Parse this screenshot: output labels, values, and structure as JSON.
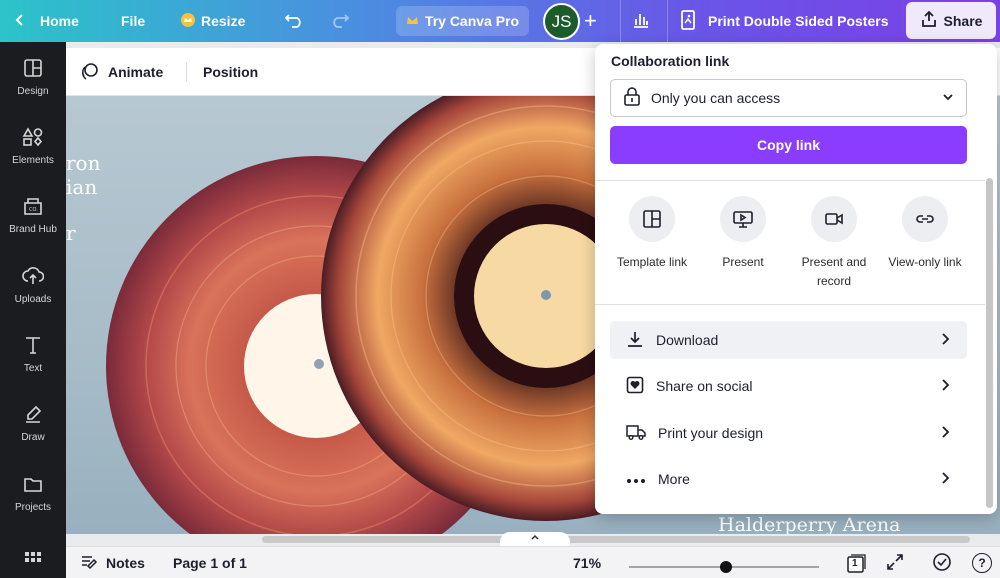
{
  "topbar": {
    "home": "Home",
    "file": "File",
    "resize": "Resize",
    "try_pro": "Try Canva Pro",
    "avatar_initials": "JS",
    "plus": "+",
    "design_title": "Print Double Sided Posters",
    "share": "Share"
  },
  "sidebar": {
    "items": [
      {
        "label": "Design",
        "icon": "design-icon"
      },
      {
        "label": "Elements",
        "icon": "elements-icon"
      },
      {
        "label": "Brand Hub",
        "icon": "brand-hub-icon"
      },
      {
        "label": "Uploads",
        "icon": "uploads-icon"
      },
      {
        "label": "Text",
        "icon": "text-icon"
      },
      {
        "label": "Draw",
        "icon": "draw-icon"
      },
      {
        "label": "Projects",
        "icon": "projects-icon"
      }
    ]
  },
  "toolbar2": {
    "animate": "Animate",
    "position": "Position"
  },
  "canvas": {
    "text_lines": [
      "ron",
      "ian",
      "r"
    ],
    "venue": "Halderperry Arena"
  },
  "bottombar": {
    "notes": "Notes",
    "page": "Page 1 of 1",
    "zoom": "71%",
    "zoom_level": 0.51,
    "pages_count": "1",
    "help": "?"
  },
  "share_panel": {
    "heading": "Collaboration link",
    "access": "Only you can access",
    "copy_link": "Copy link",
    "options": [
      {
        "label": "Template link",
        "icon": "template-link-icon"
      },
      {
        "label": "Present",
        "icon": "present-icon"
      },
      {
        "label": "Present and record",
        "icon": "present-record-icon"
      },
      {
        "label": "View-only link",
        "icon": "view-only-link-icon"
      }
    ],
    "rows": [
      {
        "label": "Download",
        "icon": "download-icon"
      },
      {
        "label": "Share on social",
        "icon": "share-social-icon"
      },
      {
        "label": "Print your design",
        "icon": "print-truck-icon"
      },
      {
        "label": "More",
        "icon": "more-icon"
      }
    ]
  },
  "colors": {
    "accent": "#8b3dff",
    "sidebar_bg": "#1a1c20",
    "avatar_bg": "#1b5b2c"
  }
}
